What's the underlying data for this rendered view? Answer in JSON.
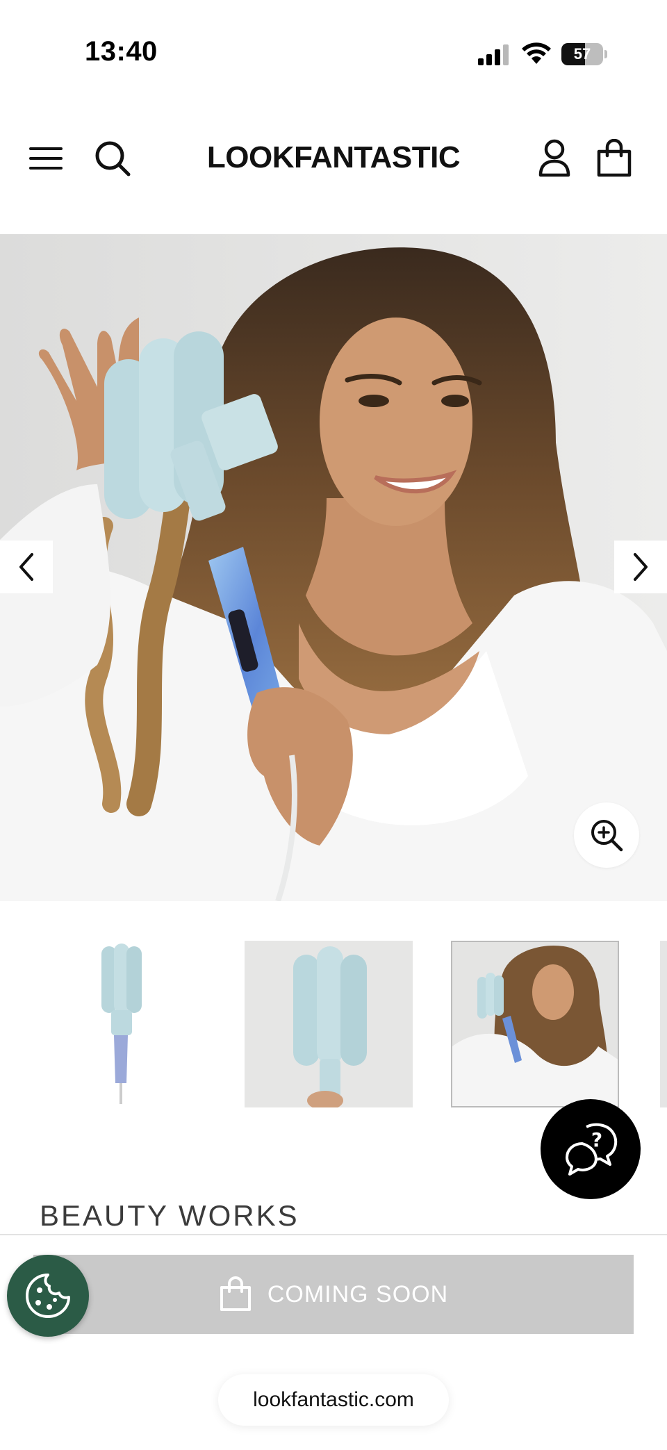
{
  "status_bar": {
    "time": "13:40",
    "battery": "57",
    "battery_level": 0.57,
    "icons": [
      "signal-icon",
      "wifi-icon",
      "battery-icon"
    ]
  },
  "header": {
    "logo": "LOOKFANTASTIC",
    "icons": [
      "menu-icon",
      "search-icon",
      "account-icon",
      "bag-icon"
    ]
  },
  "gallery": {
    "icons": [
      "chevron-left-icon",
      "chevron-right-icon",
      "zoom-in-icon"
    ],
    "thumbnail_count": 4
  },
  "product": {
    "brand": "BEAUTY WORKS",
    "cta_label": "COMING SOON",
    "cta_icon": "shopping-bag-icon"
  },
  "widgets": {
    "help_icon": "chat-help-icon",
    "cookie_icon": "cookie-icon"
  },
  "browser": {
    "url": "lookfantastic.com"
  },
  "colors": {
    "cta_background": "#c9c9c9",
    "cookie_button": "#2b5b46",
    "help_button": "#000000",
    "waver_barrel": "#bcd9df"
  }
}
